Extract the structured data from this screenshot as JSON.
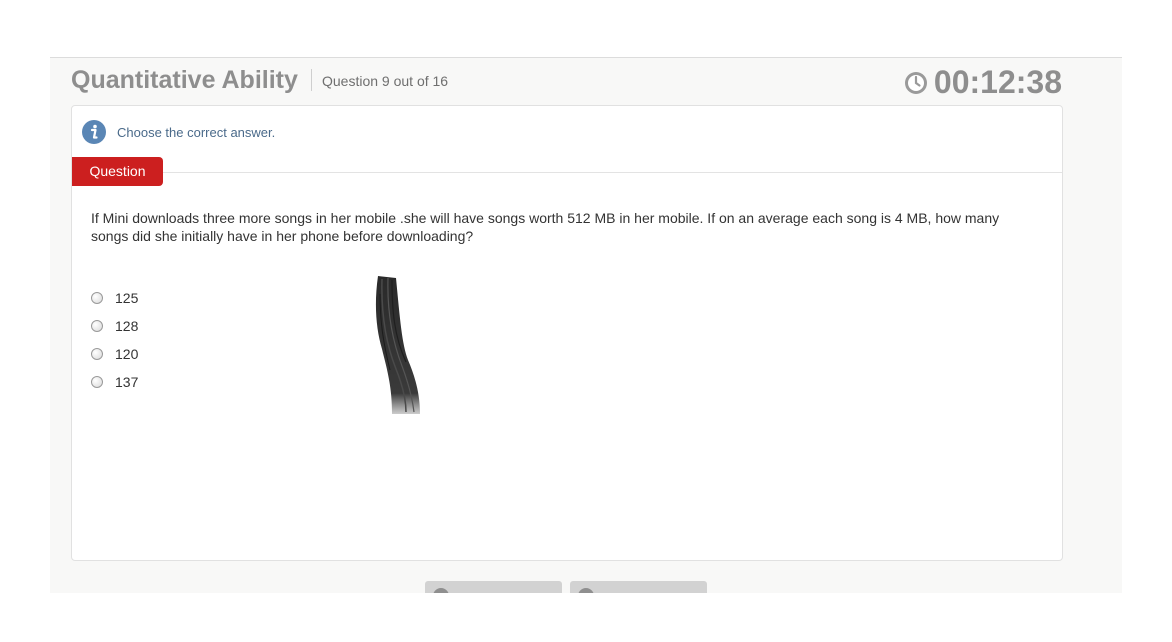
{
  "header": {
    "title": "Quantitative Ability",
    "question_counter": "Question 9 out of 16",
    "timer": "00:12:38"
  },
  "instruction": {
    "text": "Choose the correct answer.",
    "icon": "info-icon"
  },
  "question": {
    "tab_label": "Question",
    "text": "If Mini downloads three more songs in her mobile .she will have songs worth 512 MB in her mobile. If on an average each song is 4 MB, how many songs did she initially have in her phone before downloading?",
    "options": [
      "125",
      "128",
      "120",
      "137"
    ]
  },
  "colors": {
    "accent_red": "#cc1f1f",
    "title_gray": "#8e8e8e",
    "info_blue": "#5a86b5"
  }
}
